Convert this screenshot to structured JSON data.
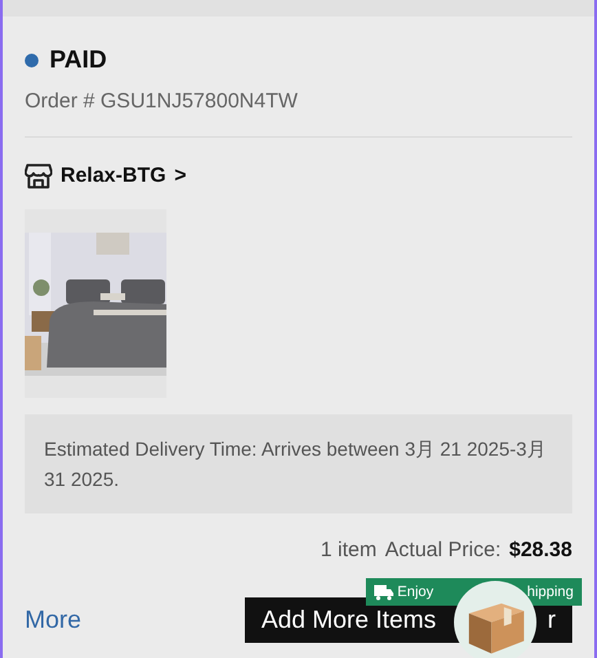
{
  "order": {
    "status": {
      "label": "PAID",
      "color": "#2f6bab"
    },
    "order_number": "Order # GSU1NJ57800N4TW"
  },
  "store": {
    "name": "Relax-BTG",
    "chevron": ">"
  },
  "delivery": "Estimated Delivery Time: Arrives between 3月 21 2025-3月 31 2025.",
  "summary": {
    "count": "1 item",
    "price_label": "Actual Price:",
    "price": "$28.38"
  },
  "actions": {
    "more": "More",
    "add_button": [
      "Add More Items",
      "r"
    ],
    "badge": [
      "Enjoy",
      "hipping"
    ]
  }
}
